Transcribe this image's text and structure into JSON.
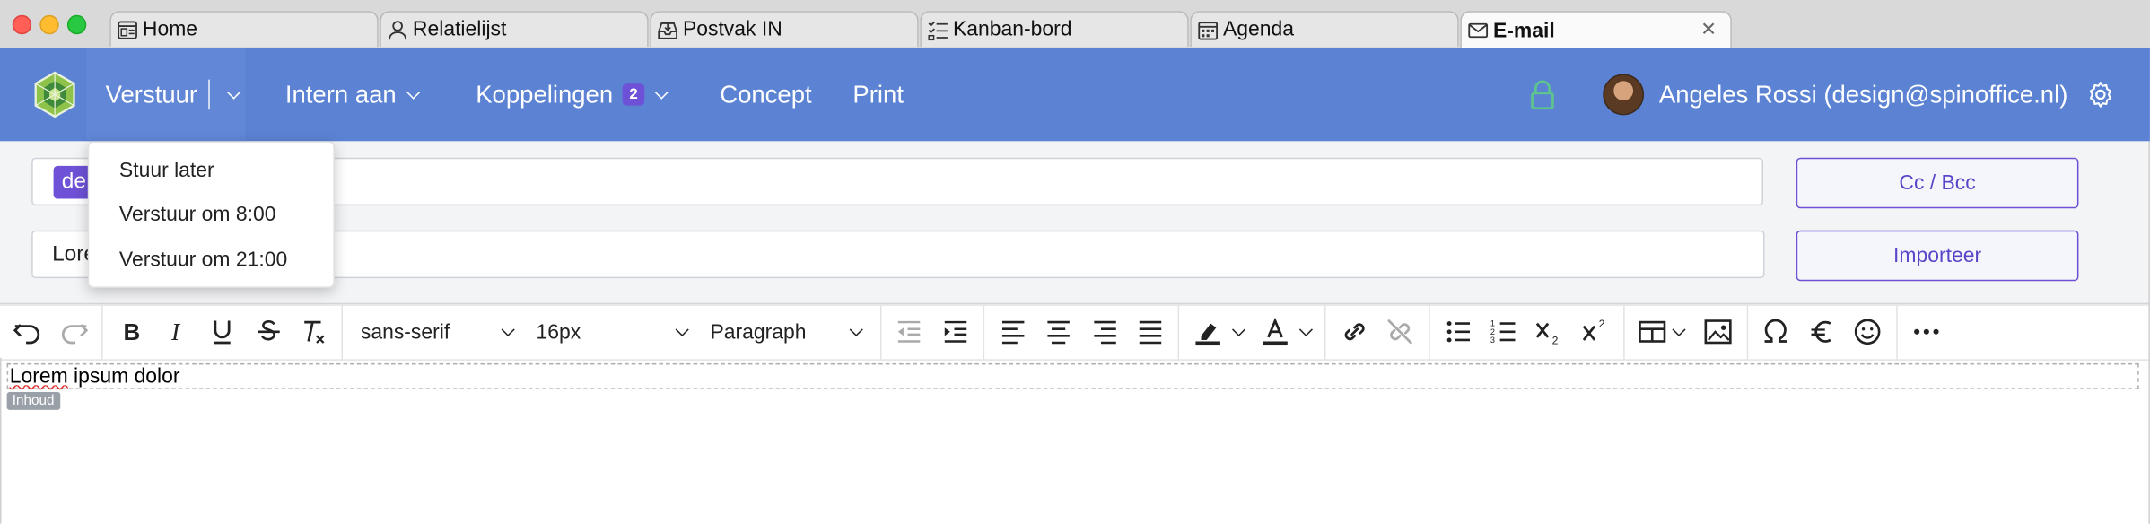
{
  "browser": {
    "tabs": [
      {
        "label": "Home",
        "icon": "home-page-icon"
      },
      {
        "label": "Relatielijst",
        "icon": "person-icon"
      },
      {
        "label": "Postvak IN",
        "icon": "inbox-icon"
      },
      {
        "label": "Kanban-bord",
        "icon": "checklist-icon"
      },
      {
        "label": "Agenda",
        "icon": "calendar-icon"
      },
      {
        "label": "E-mail",
        "icon": "envelope-icon",
        "active": true
      }
    ],
    "close_glyph": "✕"
  },
  "header": {
    "send_label": "Verstuur",
    "internal_label": "Intern aan",
    "links_label": "Koppelingen",
    "links_count": "2",
    "draft_label": "Concept",
    "print_label": "Print",
    "user_label": "Angeles Rossi (design@spinoffice.nl)",
    "colors": {
      "bar": "#5b82d3",
      "accent": "#6e51d6",
      "lock": "#5ec48e"
    }
  },
  "send_menu": {
    "items": [
      "Stuur later",
      "Verstuur om 8:00",
      "Verstuur om 21:00"
    ]
  },
  "compose": {
    "to_chip": "de",
    "subject_value": "Lore",
    "cc_label": "Cc / Bcc",
    "import_label": "Importeer"
  },
  "toolbar": {
    "font_family": "sans-serif",
    "font_size": "16px",
    "block_format": "Paragraph"
  },
  "editor": {
    "first": "Lorem",
    "middle": " ",
    "rest": "ipsum dolor",
    "content_tag": "Inhoud"
  }
}
